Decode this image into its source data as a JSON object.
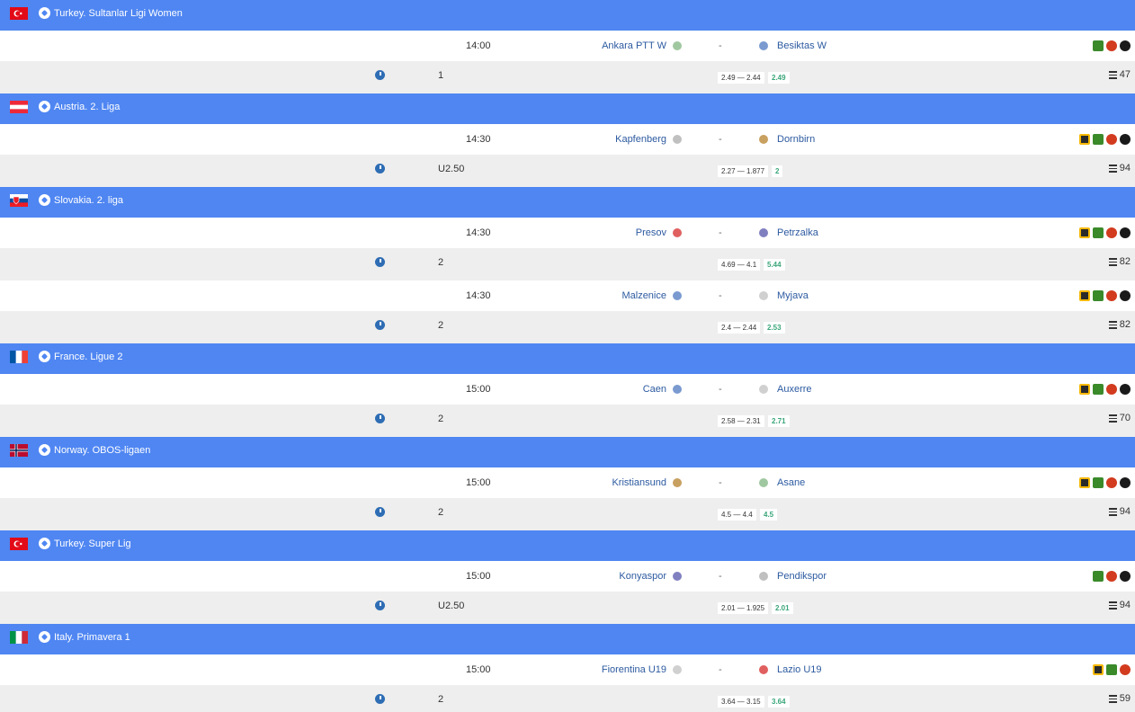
{
  "leagues": [
    {
      "name": "Turkey. Sultanlar Ligi Women",
      "flag": "turkey",
      "matches": [
        {
          "time": "14:00",
          "home": "Ankara PTT W",
          "away": "Besiktas W",
          "line": "1",
          "odds_a": "2.49",
          "odds_b": "2.44",
          "best": "2.49",
          "count": "47",
          "icons": [
            "green",
            "red",
            "black"
          ]
        }
      ]
    },
    {
      "name": "Austria. 2. Liga",
      "flag": "austria",
      "matches": [
        {
          "time": "14:30",
          "home": "Kapfenberg",
          "away": "Dornbirn",
          "line": "U2.50",
          "odds_a": "2.27",
          "odds_b": "1.877",
          "best": "2",
          "count": "94",
          "icons": [
            "bee",
            "green",
            "red",
            "black"
          ]
        }
      ]
    },
    {
      "name": "Slovakia. 2. liga",
      "flag": "slovakia",
      "matches": [
        {
          "time": "14:30",
          "home": "Presov",
          "away": "Petrzalka",
          "line": "2",
          "odds_a": "4.69",
          "odds_b": "4.1",
          "best": "5.44",
          "count": "82",
          "icons": [
            "bee",
            "green",
            "red",
            "black"
          ]
        },
        {
          "time": "14:30",
          "home": "Malzenice",
          "away": "Myjava",
          "line": "2",
          "odds_a": "2.4",
          "odds_b": "2.44",
          "best": "2.53",
          "count": "82",
          "icons": [
            "bee",
            "green",
            "red",
            "black"
          ]
        }
      ]
    },
    {
      "name": "France. Ligue 2",
      "flag": "france",
      "matches": [
        {
          "time": "15:00",
          "home": "Caen",
          "away": "Auxerre",
          "line": "2",
          "odds_a": "2.58",
          "odds_b": "2.31",
          "best": "2.71",
          "count": "70",
          "icons": [
            "bee",
            "green",
            "red",
            "black"
          ]
        }
      ]
    },
    {
      "name": "Norway. OBOS-ligaen",
      "flag": "norway",
      "matches": [
        {
          "time": "15:00",
          "home": "Kristiansund",
          "away": "Asane",
          "line": "2",
          "odds_a": "4.5",
          "odds_b": "4.4",
          "best": "4.5",
          "count": "94",
          "icons": [
            "bee",
            "green",
            "red",
            "black"
          ]
        }
      ]
    },
    {
      "name": "Turkey. Super Lig",
      "flag": "turkey",
      "matches": [
        {
          "time": "15:00",
          "home": "Konyaspor",
          "away": "Pendikspor",
          "line": "U2.50",
          "odds_a": "2.01",
          "odds_b": "1.925",
          "best": "2.01",
          "count": "94",
          "icons": [
            "green",
            "red",
            "black"
          ]
        }
      ]
    },
    {
      "name": "Italy. Primavera 1",
      "flag": "italy",
      "matches": [
        {
          "time": "15:00",
          "home": "Fiorentina U19",
          "away": "Lazio U19",
          "line": "2",
          "odds_a": "3.64",
          "odds_b": "3.15",
          "best": "3.64",
          "count": "59",
          "icons": [
            "bee",
            "green",
            "red"
          ]
        }
      ]
    }
  ],
  "separator": "-",
  "odds_joiner": " — ",
  "colors": {
    "header_bg": "#4f86f2",
    "odds_row_bg": "#eeeeee",
    "team_link": "#2c5aa0",
    "best_odds": "#3aa67a",
    "clock": "#2e6db4"
  }
}
